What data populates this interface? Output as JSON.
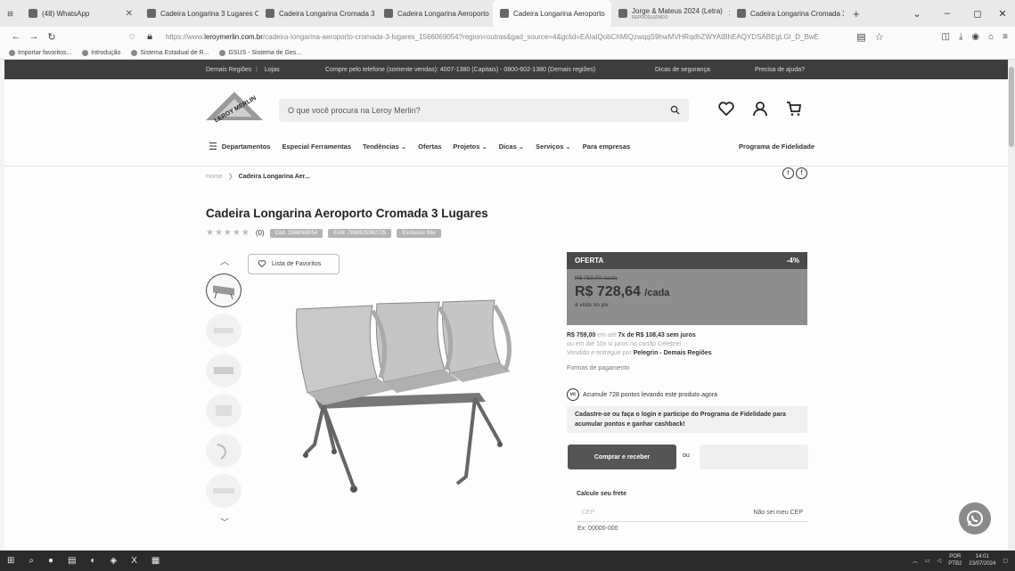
{
  "browser": {
    "tabs": [
      {
        "label": "(48) WhatsApp",
        "active": false
      },
      {
        "label": "Cadeira Longarina 3 Lugares C",
        "active": false
      },
      {
        "label": "Cadeira Longarina Cromada 3",
        "active": false
      },
      {
        "label": "Cadeira Longarina Aeroporto",
        "active": false
      },
      {
        "label": "Cadeira Longarina Aeroporto",
        "active": true
      },
      {
        "label": "Jorge & Mateus 2024 (Letra)",
        "sub": "REPRODUZINDO",
        "active": false
      },
      {
        "label": "Cadeira Longarina Cromada 3",
        "active": false
      }
    ],
    "url_prefix": "https://www.",
    "url_host": "leroymerlin.com.br",
    "url_rest": "/cadeira-longarina-aeroporto-cromada-3-lugares_1566069054?region=outras&gad_source=4&gclid=EAIaIQobChMIQzwqqS9hwMVHRqdhZWYAtBhEAQYDSABEgLGt_D_BwE",
    "bookmarks": [
      "Importar favoritos...",
      "Introdução",
      "Sistema Estadual de R...",
      "GSUS - Sistema de Ges..."
    ]
  },
  "site": {
    "topstrip": {
      "regions": "Demais Regiões",
      "stores": "Lojas",
      "phone": "Compre pelo telefone (somente vendas): 4007-1380 (Capitais) - 0800-602-1380 (Demais regiões)",
      "safety": "Dicas de segurança",
      "help": "Precisa de ajuda?"
    },
    "logo_text": "LEROY MERLIN",
    "search_placeholder": "O que você procura na Leroy Merlin?",
    "menu": [
      "Departamentos",
      "Especial Ferramentas",
      "Tendências ⌄",
      "Ofertas",
      "Projetos ⌄",
      "Dicas ⌄",
      "Serviços ⌄",
      "Para empresas"
    ],
    "menu_right": "Programa de Fidelidade"
  },
  "breadcrumb": {
    "home": "Home",
    "current": "Cadeira Longarina Aer..."
  },
  "product": {
    "title": "Cadeira Longarina Aeroporto Cromada 3 Lugares",
    "rating_count": "(0)",
    "badges": [
      "Cód. 1566069054",
      "EAN: 7898625962725",
      "Exclusivo Site"
    ],
    "favorites_label": "Lista de Favoritos"
  },
  "offer": {
    "label": "OFERTA",
    "discount": "-4%",
    "old_price": "R$ 759,00 /cada",
    "price": "R$ 728,64",
    "unit": "/cada",
    "pix": "à vista no pix"
  },
  "info": {
    "installments_price": "R$ 759,00",
    "installments_mid": " em até ",
    "installments": "7x de R$ 108,43 sem juros",
    "card_line": "ou em até 10x s/ juros no cartão Celebre!",
    "seller_prefix": "Vendido e entregue por ",
    "seller": "Pelegrin - Demais Regiões",
    "payment_forms": "Formas de pagamento",
    "points_badge": "vc",
    "points": "Acumule 728 pontos levando este produto agora",
    "cashback": "Cadastre-se ou faça o login e participe do Programa de Fidelidade para acumular pontos e ganhar cashback!",
    "buy_label": "Comprar e receber",
    "or": "ou",
    "freight_title": "Calcule seu frete",
    "cep_placeholder": "CEP",
    "cep_unknown": "Não sei meu CEP",
    "cep_example": "Ex: 00000-000"
  },
  "taskbar": {
    "lang": "POR",
    "lang2": "PTB2",
    "time": "14:01",
    "date": "23/07/2024"
  }
}
